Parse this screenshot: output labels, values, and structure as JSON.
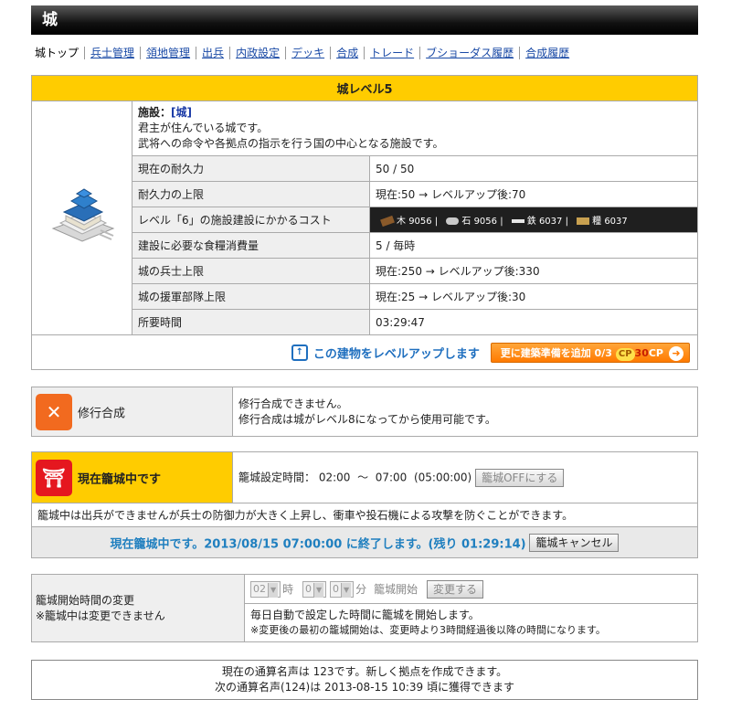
{
  "title": "城",
  "tabs": [
    "城トップ",
    "兵士管理",
    "領地管理",
    "出兵",
    "内政設定",
    "デッキ",
    "合成",
    "トレード",
    "ブショーダス履歴",
    "合成履歴"
  ],
  "castle": {
    "header": "城レベル5",
    "facility_label": "施設：",
    "facility_name": "[城]",
    "desc1": "君主が住んでいる城です。",
    "desc2": "武将への命令や各拠点の指示を行う国の中心となる施設です。",
    "rows": [
      {
        "label": "現在の耐久力",
        "value": "50 / 50"
      },
      {
        "label": "耐久力の上限",
        "value": "現在:50 → レベルアップ後:70"
      },
      {
        "label": "レベル「6」の施設建設にかかるコスト",
        "value": ""
      },
      {
        "label": "建設に必要な食糧消費量",
        "value": "5 / 毎時"
      },
      {
        "label": "城の兵士上限",
        "value": "現在:250 → レベルアップ後:330"
      },
      {
        "label": "城の援軍部隊上限",
        "value": "現在:25 → レベルアップ後:30"
      },
      {
        "label": "所要時間",
        "value": "03:29:47"
      }
    ],
    "cost": {
      "wood_label": "木",
      "wood": "9056",
      "stone_label": "石",
      "stone": "9056",
      "iron_label": "鉄",
      "iron": "6037",
      "food_label": "糧",
      "food": "6037"
    },
    "levelup_link": "この建物をレベルアップします",
    "prep_button": "更に建築準備を追加 0/3",
    "cp_badge": "CP",
    "cp_value": "30",
    "cp_unit": "CP"
  },
  "training": {
    "label": "修行合成",
    "line1": "修行合成できません。",
    "line2": "修行合成は城がレベル8になってから使用可能です。"
  },
  "siege": {
    "label": "現在籠城中です",
    "time_label": "籠城設定時間：",
    "time_start": "02:00",
    "tilde": "〜",
    "time_end": "07:00",
    "duration": "(05:00:00)",
    "off_button": "籠城OFFにする",
    "note": "籠城中は出兵ができませんが兵士の防御力が大きく上昇し、衝車や投石機による攻撃を防ぐことができます。",
    "status": "現在籠城中です。2013/08/15 07:00:00 に終了します。(残り 01:29:14)",
    "cancel_button": "籠城キャンセル"
  },
  "start_change": {
    "label1": "籠城開始時間の変更",
    "label2": "※籠城中は変更できません",
    "hour": "02",
    "hour_unit": "時",
    "min1": "0",
    "min2": "0",
    "min_unit": "分",
    "start_label": "籠城開始",
    "change_button": "変更する",
    "info1": "毎日自動で設定した時間に籠城を開始します。",
    "info2": "※変更後の最初の籠城開始は、変更時より3時間経過後以降の時間になります。"
  },
  "fame": {
    "line1": "現在の通算名声は 123です。新しく拠点を作成できます。",
    "line2": "次の通算名声(124)は  2013-08-15 10:39 頃に獲得できます"
  },
  "colors": {
    "header_yellow": "#ffcc00",
    "link_blue": "#1f7fbf",
    "orange": "#ff7a00"
  }
}
